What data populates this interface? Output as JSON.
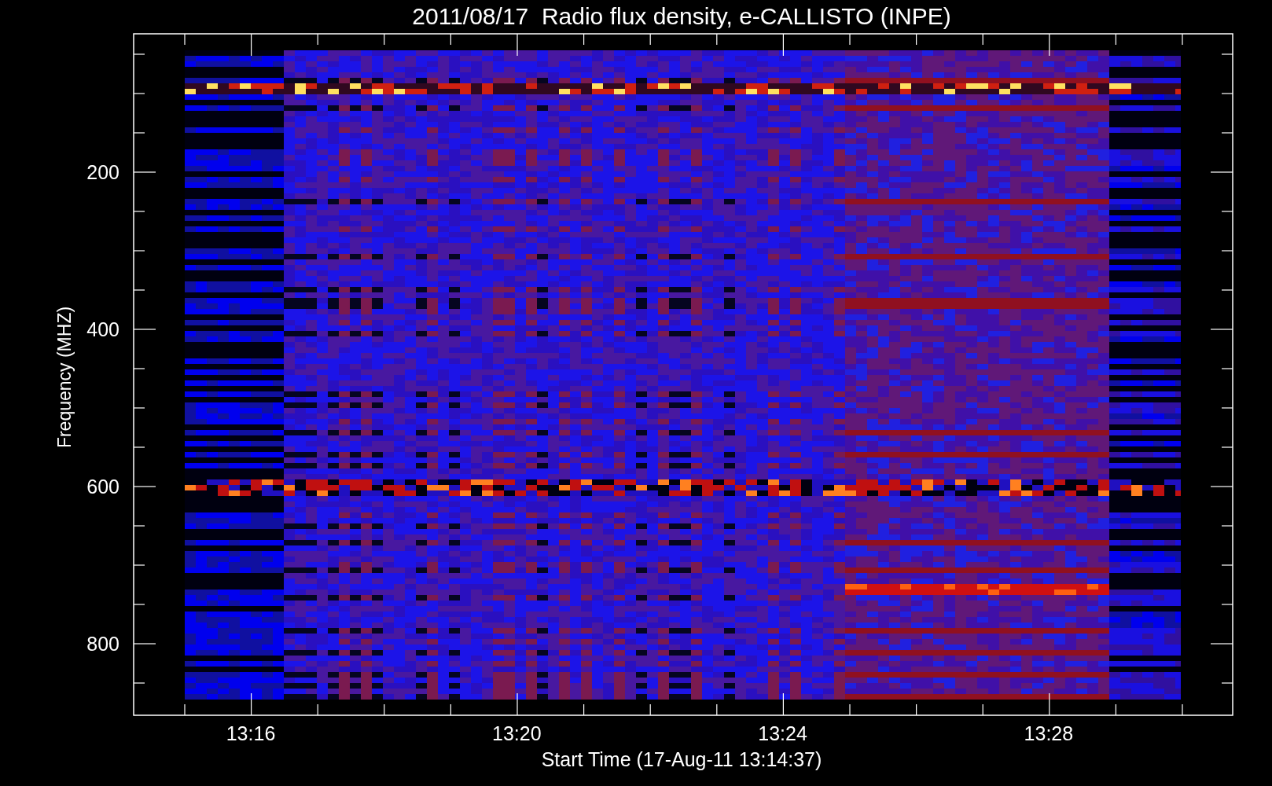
{
  "title": "2011/08/17  Radio flux density, e-CALLISTO (INPE)",
  "y_axis": {
    "label": "Frequency (MHZ)",
    "ticks": [
      "200",
      "400",
      "600",
      "800"
    ]
  },
  "x_axis": {
    "label": "Start Time (17-Aug-11 13:14:37)",
    "ticks": [
      "13:16",
      "13:20",
      "13:24",
      "13:28"
    ]
  }
}
